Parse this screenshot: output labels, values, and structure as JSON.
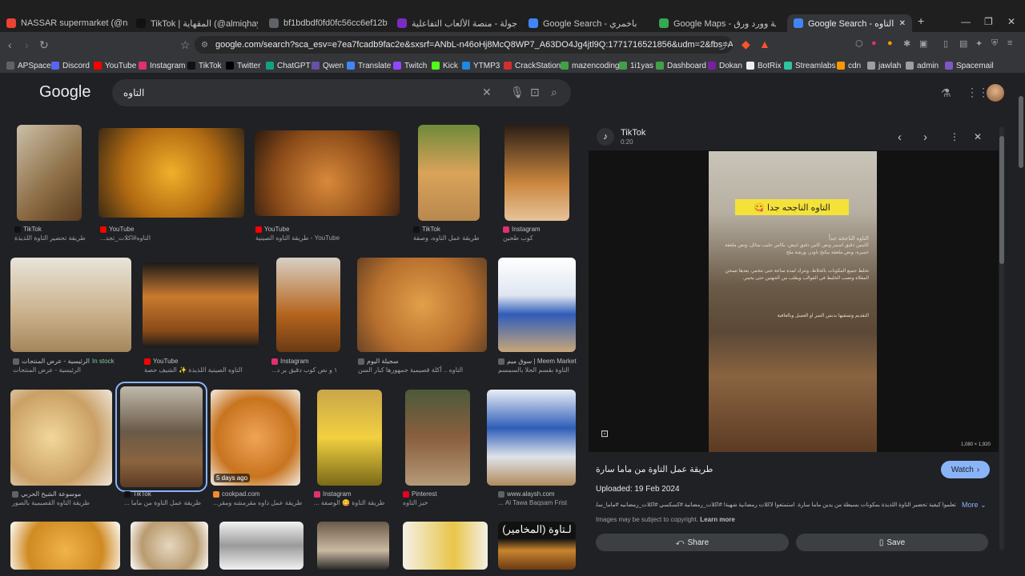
{
  "tabs": [
    {
      "label": "NASSAR supermarket (@nassar_sup",
      "fav_color": "#ea4335"
    },
    {
      "label": "TikTok | المقهاية (@almiqhaya1)",
      "fav_color": "#111111"
    },
    {
      "label": "bf1bdbdf0fd0fc56cc6ef12bf100b763",
      "fav_color": "#5f6368"
    },
    {
      "label": "جولة - منصة الألعاب التفاعلية - Jawlah",
      "fav_color": "#7b2cbf"
    },
    {
      "label": "Google Search - باخمري",
      "fav_color": "#4285f4"
    },
    {
      "label": "Google Maps - بوغية وورد ورق",
      "fav_color": "#34a853"
    },
    {
      "label": "Google Search - التاوه",
      "fav_color": "#4285f4"
    }
  ],
  "address": {
    "url": "google.com/search?sca_esv=e7ea7fcadb9fac2e&sxsrf=ANbL-n46oHj8McQ8WP7_A63DO4Jg4jtl9Q:1771716521856&udm=2&fbs=ADc_l-aN0CWEZB..."
  },
  "bookmarks": [
    {
      "label": "APSpace",
      "color": "#5f6368"
    },
    {
      "label": "Discord",
      "color": "#5865f2"
    },
    {
      "label": "YouTube",
      "color": "#ff0000"
    },
    {
      "label": "Instagram",
      "color": "#e1306c"
    },
    {
      "label": "TikTok",
      "color": "#111111"
    },
    {
      "label": "Twitter",
      "color": "#000000"
    },
    {
      "label": "ChatGPT",
      "color": "#10a37f"
    },
    {
      "label": "Qwen",
      "color": "#6750a4"
    },
    {
      "label": "Translate",
      "color": "#4285f4"
    },
    {
      "label": "Twitch",
      "color": "#9146ff"
    },
    {
      "label": "Kick",
      "color": "#53fc18"
    },
    {
      "label": "YTMP3",
      "color": "#1e88e5"
    },
    {
      "label": "CrackStation",
      "color": "#d32f2f"
    },
    {
      "label": "mazencoding",
      "color": "#43a047"
    },
    {
      "label": "1i1yas",
      "color": "#43a047"
    },
    {
      "label": "Dashboard",
      "color": "#43a047"
    },
    {
      "label": "Dokan",
      "color": "#7b1fa2"
    },
    {
      "label": "BotRix",
      "color": "#eeeeee"
    },
    {
      "label": "Streamlabs",
      "color": "#31c3a2"
    },
    {
      "label": "cdn",
      "color": "#ff9800"
    },
    {
      "label": "jawlah",
      "color": "#9e9e9e"
    },
    {
      "label": "admin",
      "color": "#9e9e9e"
    },
    {
      "label": "Spacemail",
      "color": "#7e57c2"
    }
  ],
  "search": {
    "logo": "Google",
    "query": "التاوه"
  },
  "results": [
    {
      "src": "TikTok",
      "title": "طريقة تحضير التاوة اللذيذة",
      "src_color": "#111111",
      "ph": "linear-gradient(135deg,#cbbfa8,#8a6b43 60%,#5a3c1f)"
    },
    {
      "src": "YouTube",
      "title": "التاوه#اكلات_تجد...",
      "src_color": "#ff0000",
      "ph": "radial-gradient(circle at 50% 50%,#f0b02b,#b26b12 55%,#3d2a14)"
    },
    {
      "src": "YouTube",
      "title": "YouTube - طريقة التاوه الصينية",
      "src_color": "#ff0000",
      "ph": "radial-gradient(circle at 50% 60%,#d98a3a,#8a4a18 60%,#2a1a10)"
    },
    {
      "src": "TikTok",
      "title": "طريقة عمل التاوه، وصفة",
      "src_color": "#111111",
      "ph": "linear-gradient(180deg,#6f8a3a,#d9a35a 50%,#b8884e)"
    },
    {
      "src": "Instagram",
      "title": "كوب طحين",
      "src_color": "#e1306c",
      "ph": "linear-gradient(180deg,#2a1e16,#c9853d 60%,#e7c39a)"
    },
    {
      "src": "الرئيسية - عرض المنتجات",
      "title": "الرئيسية - عرض المنتجات",
      "stock": "In stock",
      "src_color": "#5f6368",
      "ph": "linear-gradient(180deg,#e9e4da,#c9b08a 60%,#a5865c)"
    },
    {
      "src": "YouTube",
      "title": "التاوه الصينية اللذيذة ✨ الشيف حصة",
      "src_color": "#ff0000",
      "ph": "linear-gradient(180deg,#1a1a1a,#c97a2e 40%,#8a4a18 80%,#1a1a1a)"
    },
    {
      "src": "Instagram",
      "title": "١ و نص كوب دقيق بر د...",
      "src_color": "#e1306c",
      "ph": "linear-gradient(180deg,#d8cfc4,#b5651d 60%,#6b3a14)"
    },
    {
      "src": "سجيلة اليوم",
      "title": "التاوه .. أكلة قصيمية جمهورها كبار السن",
      "src_color": "#5f6368",
      "ph": "radial-gradient(circle at 50% 50%,#e2a04a,#b8702e 60%,#6a4424)"
    },
    {
      "src": "سوق ميم | Meem Market",
      "title": "التاوة بقسم الحلا بالسمسم",
      "src_color": "#5f6368",
      "ph": "linear-gradient(180deg,#ffffff,#dfe6f1 40%,#2f5db8 60%,#c9a67a)"
    },
    {
      "src": "موسوعة الشيخ الحربي",
      "title": "طريقة التاوه القصيمية بالصور",
      "src_color": "#5f6368",
      "ph": "radial-gradient(circle at 40% 50%,#f2d79a,#caa066 60%,#eee6d8)"
    },
    {
      "src": "TikTok",
      "title": "طريقة عمل التاوة من ماما ...",
      "src_color": "#111111",
      "ph": "linear-gradient(180deg,#bfb9ab,#6a5a47 45%,#8a6440 75%,#5c3b24)"
    },
    {
      "src": "cookpad.com",
      "title": "طريقة عمل ذاوه مقرمشه ومقر...",
      "badge": "5 days ago",
      "src_color": "#f38b2d",
      "ph": "radial-gradient(circle at 50% 50%,#f0a457,#c8741f 60%,#f3ece2)"
    },
    {
      "src": "Instagram",
      "title": "طريقة التاوة 😋 الوصفة ...",
      "src_color": "#e1306c",
      "ph": "linear-gradient(180deg,#c9a64a,#f2d040 50%,#7a6a18)"
    },
    {
      "src": "Pinterest",
      "title": "خبز التاوه",
      "src_color": "#e60023",
      "ph": "linear-gradient(180deg,#4c5a3a,#8a5f3f 50%,#b59a78)"
    },
    {
      "src": "www.alaysh.com",
      "title": "Al Tawa Baqsam Frist ...",
      "src_color": "#5f6368",
      "ph": "linear-gradient(180deg,#e9eef7,#2f5db8 40%,#dfe3ea 70%,#b08a5c)"
    },
    {
      "src": "",
      "title": "",
      "src_color": "#5f6368",
      "ph": "radial-gradient(circle at 50% 60%,#f0b44a,#d08a22 60%,#fff)"
    },
    {
      "src": "",
      "title": "",
      "src_color": "#5f6368",
      "ph": "radial-gradient(circle at 50% 50%,#e6d7bf,#b99b6f 60%,#fff)"
    },
    {
      "src": "",
      "title": "",
      "src_color": "#5f6368",
      "ph": "linear-gradient(180deg,#f2f2f2,#9a9a9a 50%,#f2f2f2)"
    },
    {
      "src": "",
      "title": "",
      "src_color": "#5f6368",
      "ph": "linear-gradient(180deg,#6b5a4a,#cbb9a2 60%,#2a2a2a)"
    },
    {
      "src": "",
      "title": "",
      "src_color": "#5f6368",
      "ph": "linear-gradient(90deg,#f4f0e6,#e9c54a 60%,#f4f0e6)"
    },
    {
      "src": "",
      "title": "لـتاوة (المخامير)",
      "src_color": "#5f6368",
      "ph": "linear-gradient(180deg,#111,#111 35%,#c9852e 60%,#6b3a14)"
    }
  ],
  "panel": {
    "source": "TikTok",
    "duration": "0:20",
    "banner": "التاوه الناجحه جدا 😋",
    "overlay_lines": [
      "التاوه الناجحه جداً",
      "كاسين دقيق اسمر ونص كاس دقيق ابيض، بكاس حليب سائل، ونص ملعقة خميرة، ونص ملعقة بيكنج باودر، ورشة ملح",
      "تخلط جميع المكونات بالخلاط، وتترك لمدة ساعة حتى تتخمر، بعدها تسخن المقلاة وتصب الخليط في القوالب ويقلب من الجهتين حتى يحمر.",
      "التقديم وتسقيها بدبس التمر او العسل وبالعافية"
    ],
    "dimensions": "1,080 × 1,920",
    "title": "طريقة عمل التاوة من ماما سارة",
    "uploaded": "Uploaded: 19 Feb 2024",
    "description": "تعلموا كيفية تحضير التاوة اللذيذة بمكونات بسيطة من يدين ماما سارة. استمتعوا لاكلات رمضانية شهية! #اكلات_رمضانية #كسكسي #اكلات_رمضانيه #ماما_سارة ماما...",
    "more_label": "More",
    "copyright": "Images may be subject to copyright.",
    "learn_more": "Learn more",
    "watch_label": "Watch",
    "share_label": "Share",
    "save_label": "Save"
  }
}
